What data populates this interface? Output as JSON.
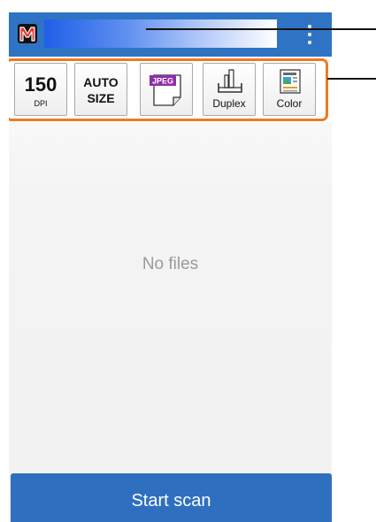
{
  "app": {
    "logo_letter": "M",
    "title": "",
    "menu_icon": "overflow-menu-icon"
  },
  "toolbar": {
    "resolution": {
      "value": "150",
      "unit": "DPI"
    },
    "size": {
      "line1": "AUTO",
      "line2": "SIZE"
    },
    "format": {
      "badge": "JPEG",
      "icon": "file-jpeg-icon"
    },
    "duplex": {
      "label": "Duplex",
      "icon": "duplex-scan-icon"
    },
    "color": {
      "label": "Color",
      "icon": "color-document-icon"
    }
  },
  "main": {
    "empty_message": "No files"
  },
  "actions": {
    "start_scan_label": "Start scan"
  },
  "colors": {
    "appbar": "#2f73c4",
    "highlight": "#f07a1f",
    "scan_button": "#2f6fbf",
    "jpeg_badge": "#8e2fa8"
  }
}
